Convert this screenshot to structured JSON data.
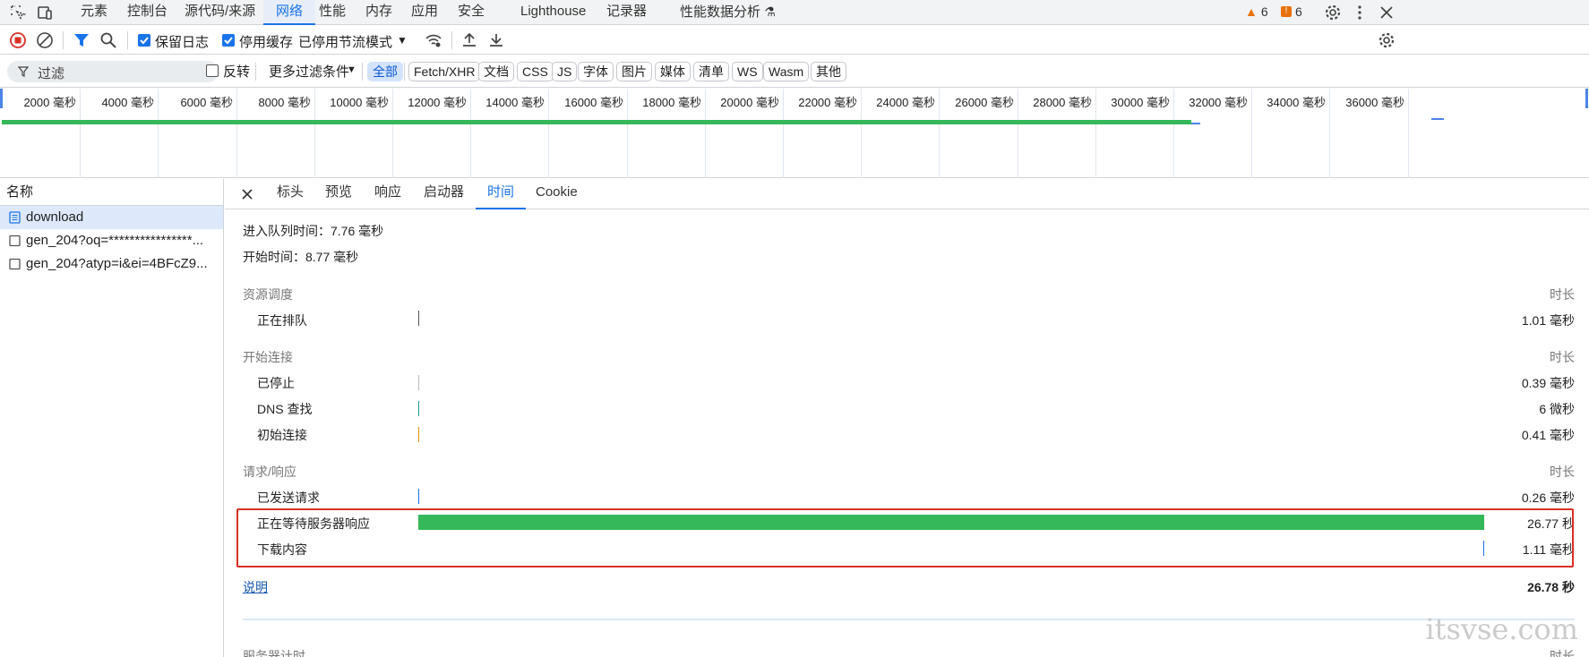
{
  "topbar": {
    "tabs": [
      "元素",
      "控制台",
      "源代码/来源",
      "网络",
      "性能",
      "内存",
      "应用",
      "安全",
      "Lighthouse",
      "记录器",
      "性能数据分析"
    ],
    "active_tab": "网络",
    "warnings_count": "6",
    "errors_count": "6"
  },
  "toolbar": {
    "preserve_log": "保留日志",
    "disable_cache": "停用缓存",
    "throttle": "已停用节流模式"
  },
  "filterbar": {
    "placeholder": "过滤",
    "invert": "反转",
    "more_filters": "更多过滤条件",
    "chips": [
      "全部",
      "Fetch/XHR",
      "文档",
      "CSS",
      "JS",
      "字体",
      "图片",
      "媒体",
      "清单",
      "WS",
      "Wasm",
      "其他"
    ]
  },
  "overview": {
    "ticks": [
      "2000 毫秒",
      "4000 毫秒",
      "6000 毫秒",
      "8000 毫秒",
      "10000 毫秒",
      "12000 毫秒",
      "14000 毫秒",
      "16000 毫秒",
      "18000 毫秒",
      "20000 毫秒",
      "22000 毫秒",
      "24000 毫秒",
      "26000 毫秒",
      "28000 毫秒",
      "30000 毫秒",
      "32000 毫秒",
      "34000 毫秒",
      "36000 毫秒"
    ]
  },
  "requests": {
    "header": "名称",
    "items": [
      "download",
      "gen_204?oq=****************...",
      "gen_204?atyp=i&ei=4BFcZ9..."
    ]
  },
  "detail": {
    "tabs": [
      "标头",
      "预览",
      "响应",
      "启动器",
      "时间",
      "Cookie"
    ],
    "active_tab": "时间",
    "queued_at": "进入队列时间：7.76 毫秒",
    "started_at": "开始时间：8.77 毫秒",
    "duration_header": "时长",
    "sections": [
      {
        "title": "资源调度",
        "rows": [
          {
            "label": "正在排队",
            "value": "1.01 毫秒"
          }
        ]
      },
      {
        "title": "开始连接",
        "rows": [
          {
            "label": "已停止",
            "value": "0.39 毫秒"
          },
          {
            "label": "DNS 查找",
            "value": "6 微秒"
          },
          {
            "label": "初始连接",
            "value": "0.41 毫秒"
          }
        ]
      },
      {
        "title": "请求/响应",
        "rows": [
          {
            "label": "已发送请求",
            "value": "0.26 毫秒"
          },
          {
            "label": "正在等待服务器响应",
            "value": "26.77 秒"
          },
          {
            "label": "下载内容",
            "value": "1.11 毫秒"
          }
        ]
      }
    ],
    "explanation": "说明",
    "total": "26.78 秒",
    "server_timing": "服务器计时",
    "colors": {
      "waiting": "#34b85a",
      "accent": "#1a73e8",
      "highlight": "#d93025"
    }
  },
  "watermark": "itsvse.com"
}
